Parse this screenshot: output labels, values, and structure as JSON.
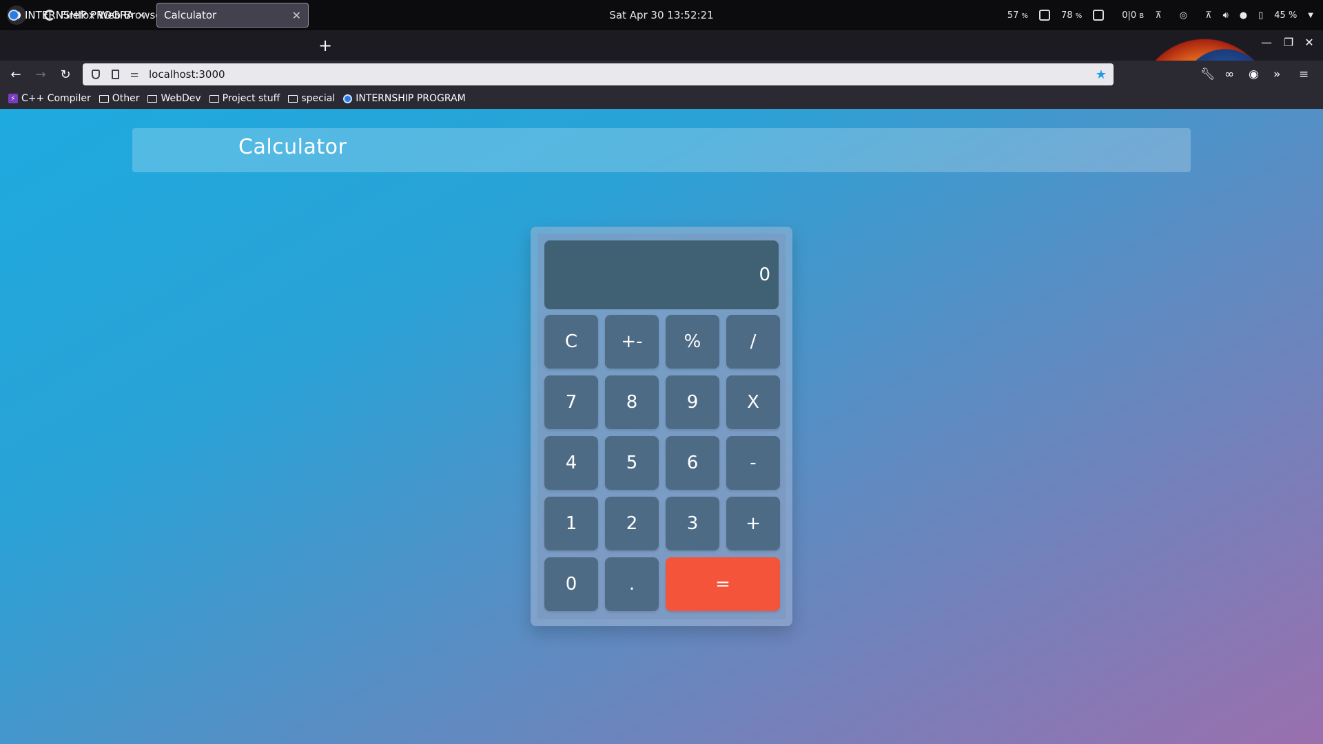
{
  "topbar": {
    "app_name": "Firefox Web Browser",
    "datetime": "Sat Apr 30  13:52:21",
    "cpu": "57",
    "mem": "78",
    "net": "0|0",
    "net_unit": "B",
    "battery": "45 %",
    "pct_unit": "%"
  },
  "tabs": [
    {
      "title": "INTERNSHIP PROGRAM",
      "active": false
    },
    {
      "title": "Calculator",
      "active": true
    }
  ],
  "navbar": {
    "url": "localhost:3000"
  },
  "bookmarks": [
    {
      "label": "C++ Compiler",
      "icon": "bolt-icon"
    },
    {
      "label": "Other",
      "icon": "folder-icon"
    },
    {
      "label": "WebDev",
      "icon": "folder-icon"
    },
    {
      "label": "Project stuff",
      "icon": "folder-icon"
    },
    {
      "label": "special",
      "icon": "folder-icon"
    },
    {
      "label": "INTERNSHIP PROGRAM",
      "icon": "site-favicon"
    }
  ],
  "page": {
    "header_title": "Calculator",
    "display_value": "0",
    "keys": {
      "clear": "C",
      "sign": "+-",
      "percent": "%",
      "divide": "/",
      "seven": "7",
      "eight": "8",
      "nine": "9",
      "multiply": "X",
      "four": "4",
      "five": "5",
      "six": "6",
      "minus": "-",
      "one": "1",
      "two": "2",
      "three": "3",
      "plus": "+",
      "zero": "0",
      "dot": ".",
      "equals": "="
    },
    "colors": {
      "key": "#4e6b86",
      "equals": "#f4543a",
      "display": "#406173"
    }
  }
}
